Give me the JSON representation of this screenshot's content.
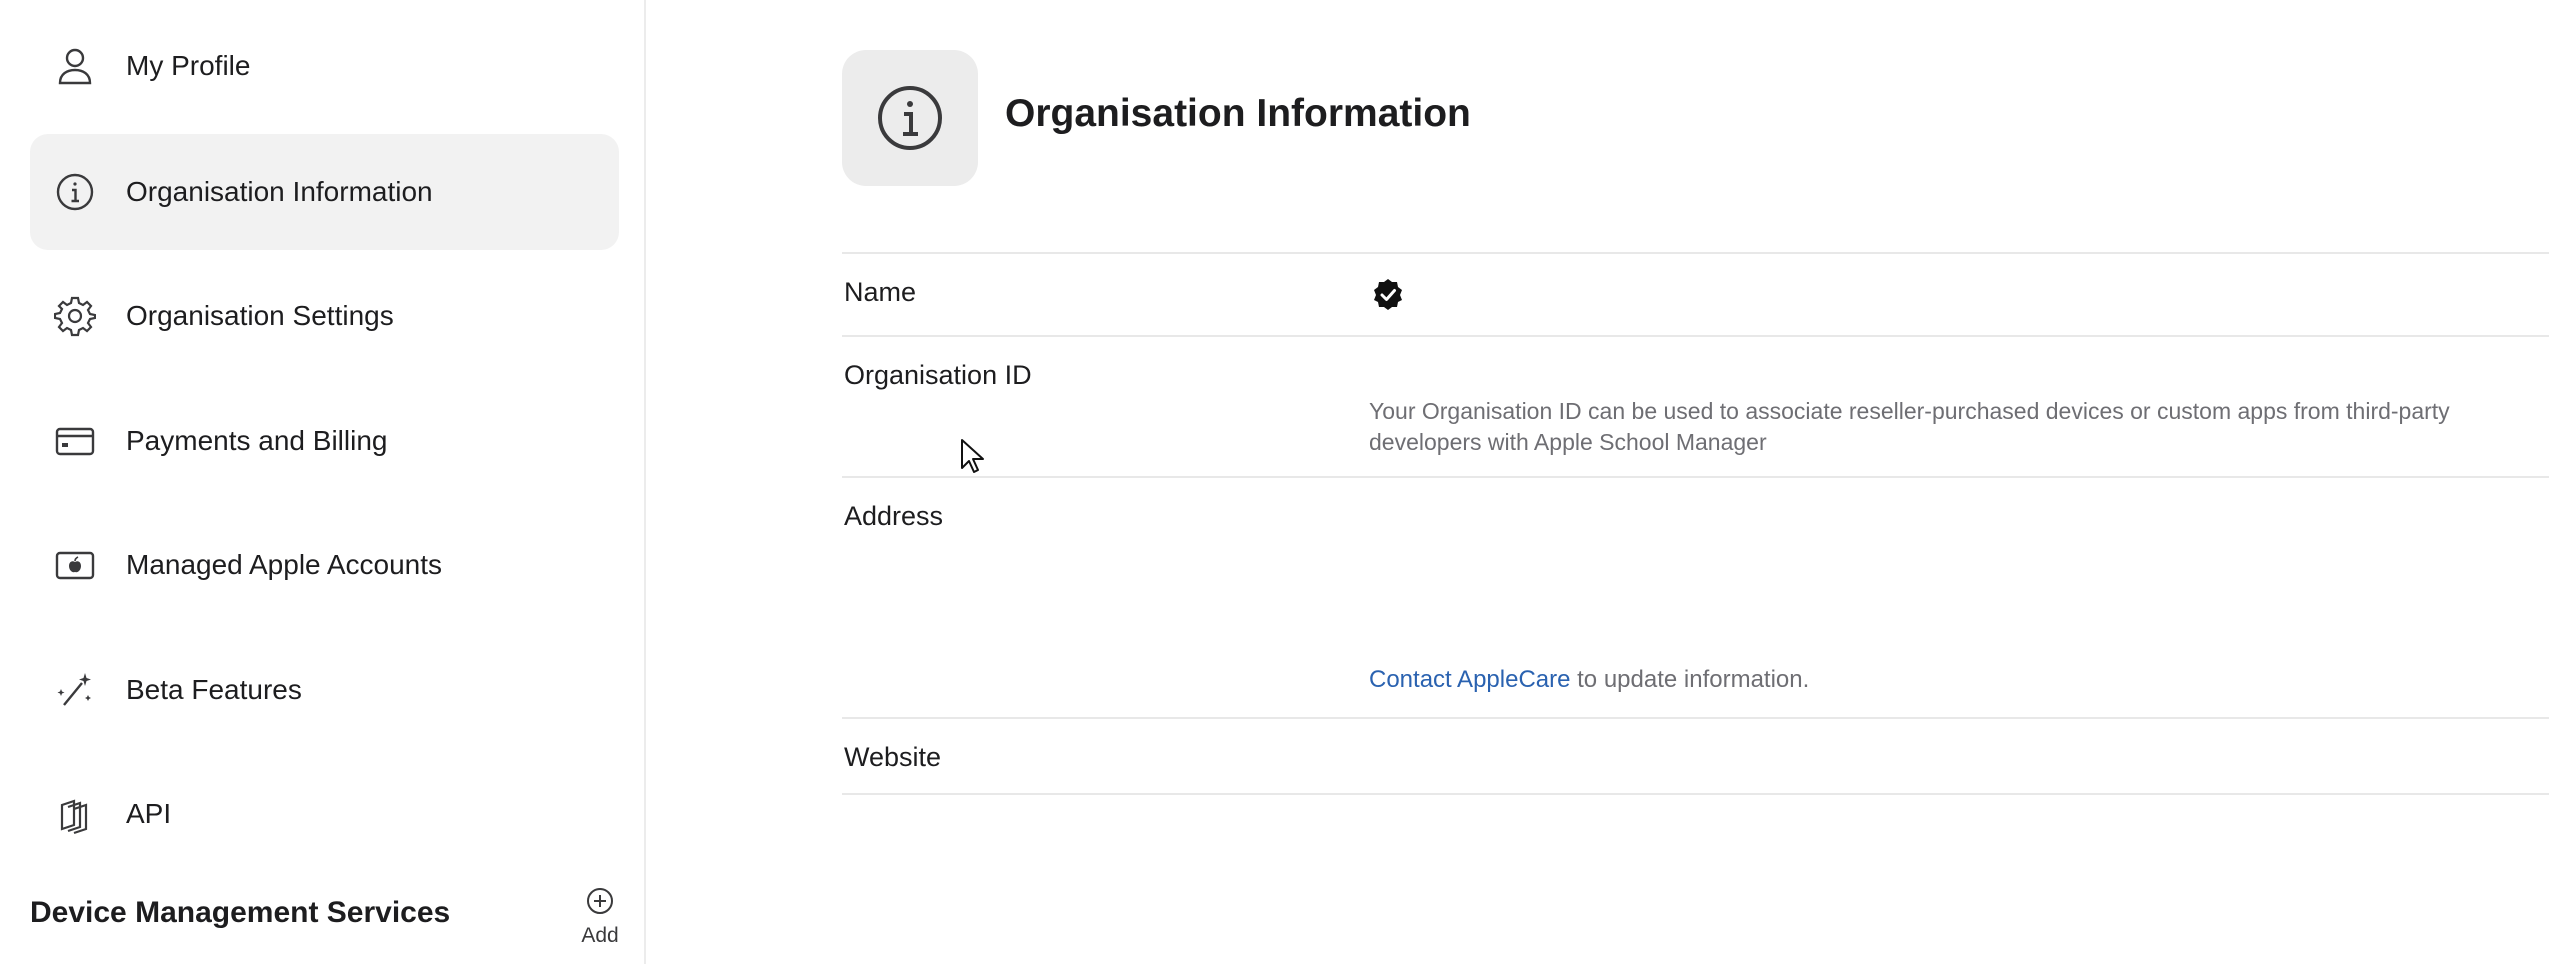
{
  "sidebar": {
    "items": [
      {
        "label": "My Profile",
        "icon": "person-icon",
        "selected": false
      },
      {
        "label": "Organisation Information",
        "icon": "info-icon",
        "selected": true
      },
      {
        "label": "Organisation Settings",
        "icon": "gear-icon",
        "selected": false
      },
      {
        "label": "Payments and Billing",
        "icon": "credit-card-icon",
        "selected": false
      },
      {
        "label": "Managed Apple Accounts",
        "icon": "apple-account-icon",
        "selected": false
      },
      {
        "label": "Beta Features",
        "icon": "magic-wand-icon",
        "selected": false
      },
      {
        "label": "API",
        "icon": "api-icon",
        "selected": false
      }
    ],
    "section_title": "Device Management Services",
    "add_label": "Add"
  },
  "main": {
    "title": "Organisation Information",
    "rows": {
      "name_label": "Name",
      "org_id_label": "Organisation ID",
      "org_id_description": "Your Organisation ID can be used to associate reseller-purchased devices or custom apps from third-party developers with Apple School Manager",
      "address_label": "Address",
      "contact_link": "Contact AppleCare",
      "contact_suffix": " to update information.",
      "website_label": "Website"
    }
  },
  "colors": {
    "accent_link": "#2a62b0",
    "selected_bg": "#f2f2f2",
    "muted_text": "#6e6e73"
  }
}
